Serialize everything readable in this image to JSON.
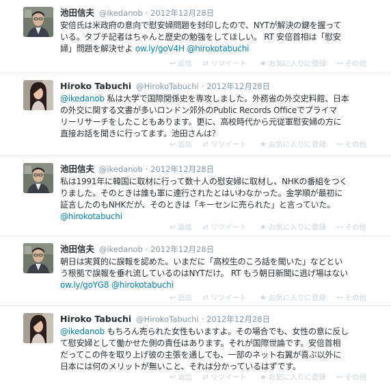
{
  "actions": {
    "reply": "返信",
    "retweet": "リツイート",
    "favorite": "お気に入りに登録",
    "more": "その他"
  },
  "tweets": [
    {
      "name": "池田信夫",
      "handle": "@ikedanob",
      "sep": "·",
      "time": "2012年12月28日",
      "avatar": "man-avatar",
      "lines": [
        [
          {
            "t": "安倍氏は米政府の意向で慰安婦問題を封印したので、NYTが解決の鍵を握って"
          }
        ],
        [
          {
            "t": "いる。タブチ記者はちゃんと歴史の勉強をしてほしい。 RT 安倍首相は「慰安"
          }
        ],
        [
          {
            "t": "婦」問題を解決せよ "
          },
          {
            "t": "ow.ly/goV4H",
            "link": true
          },
          {
            "t": " "
          },
          {
            "t": "@hirokotabuchi",
            "link": true
          }
        ]
      ]
    },
    {
      "name": "Hiroko Tabuchi",
      "handle": "@HirokoTabuchi",
      "sep": "·",
      "time": "2012年12月28日",
      "avatar": "woman-avatar",
      "lines": [
        [
          {
            "t": "@ikedanob",
            "link": true
          },
          {
            "t": " 私は大学で国際関係史を専攻しました。外務省の外交史料館、日本"
          }
        ],
        [
          {
            "t": "の外交に関する文書が多いロンドン郊外のPublic Records Officeでプライマ"
          }
        ],
        [
          {
            "t": "リーリサーチをしたこともあります。更に、高校時代から元従軍慰安婦の方に"
          }
        ],
        [
          {
            "t": "直接お話を聞きに行ってます。池田さんは？"
          }
        ]
      ]
    },
    {
      "name": "池田信夫",
      "handle": "@ikedanob",
      "sep": "·",
      "time": "2012年12月28日",
      "avatar": "man-avatar",
      "lines": [
        [
          {
            "t": "私は1991年に韓国に取材に行って数十人の慰安婦に取材し、NHKの番組をつく"
          }
        ],
        [
          {
            "t": "りました。そのときは誰も軍に連行されたとはいわなかった。金学順が最初に"
          }
        ],
        [
          {
            "t": "証言したのもNHKだが、そのときは「キーセンに売られた」と言っていた。"
          }
        ],
        [
          {
            "t": "@hirokotabuchi",
            "link": true
          }
        ]
      ]
    },
    {
      "name": "池田信夫",
      "handle": "@ikedanob",
      "sep": "·",
      "time": "2012年12月28日",
      "avatar": "man-avatar",
      "lines": [
        [
          {
            "t": "朝日は実質的に誤報を認めた。いまだに「高校生のころ話を聞いた」などとい"
          }
        ],
        [
          {
            "t": "う根拠で誤報を垂れ流しているのはNYTだけ。 RT もう朝日新聞に逃げ場はない"
          }
        ],
        [
          {
            "t": "ow.ly/goYG8",
            "link": true
          },
          {
            "t": " "
          },
          {
            "t": "@hirokotabuchi",
            "link": true
          }
        ]
      ]
    },
    {
      "name": "Hiroko Tabuchi",
      "handle": "@HirokoTabuchi",
      "sep": "·",
      "time": "2012年12月28日",
      "avatar": "woman-avatar",
      "lines": [
        [
          {
            "t": "@ikedanob",
            "link": true
          },
          {
            "t": " もちろん売られた女性もいますよ。その場合でも、女性の意に反し"
          }
        ],
        [
          {
            "t": "て慰安婦として働かせた側の責任はあります。それが国際世論です。安倍首相"
          }
        ],
        [
          {
            "t": "だってこの件を取り上げ彼の主張を通しても、一部のネット右翼が喜ぶ以外に"
          }
        ],
        [
          {
            "t": "日本には何のメリットが無いこと、それは分かっているはずです。"
          }
        ]
      ]
    }
  ]
}
